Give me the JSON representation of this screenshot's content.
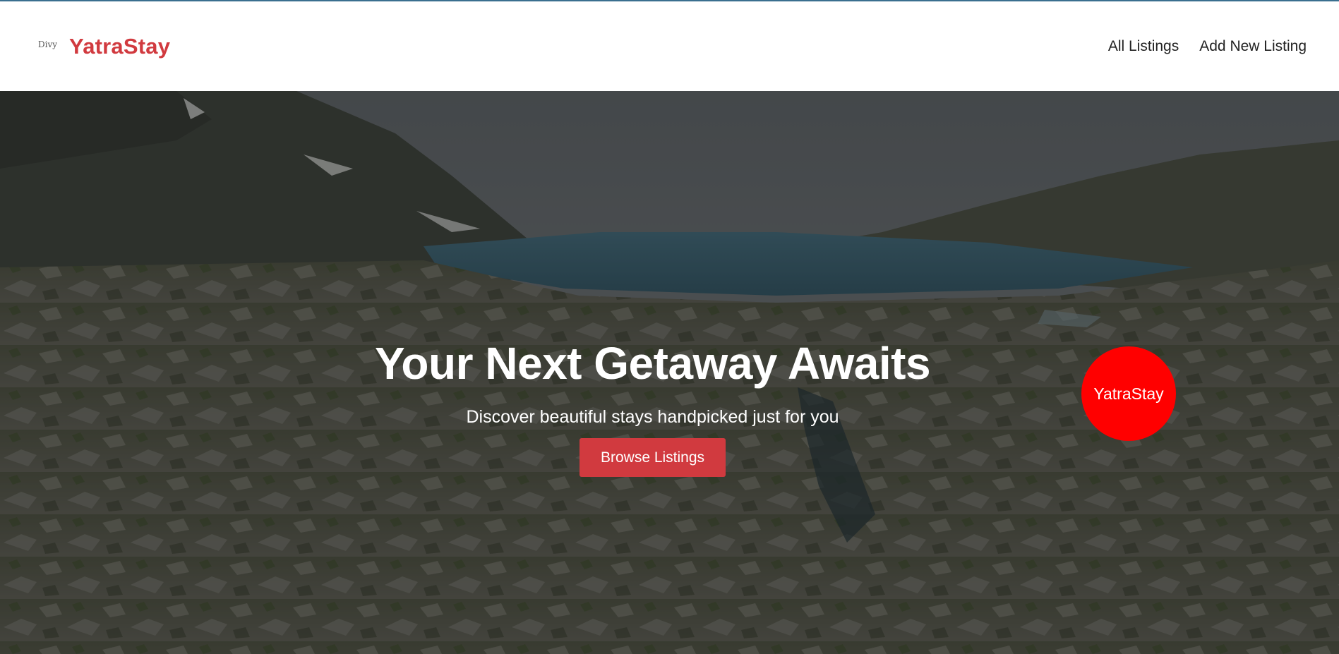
{
  "colors": {
    "accent": "#d13a3f",
    "badge": "#ff0000",
    "top_line": "#3a6f8f"
  },
  "navbar": {
    "logo_alt": "Divy",
    "brand_name": "YatraStay",
    "links": [
      {
        "label": "All Listings"
      },
      {
        "label": "Add New Listing"
      }
    ]
  },
  "hero": {
    "title": "Your Next Getaway Awaits",
    "subtitle": "Discover beautiful stays handpicked just for you",
    "button_label": "Browse Listings",
    "badge_text": "YatraStay"
  }
}
